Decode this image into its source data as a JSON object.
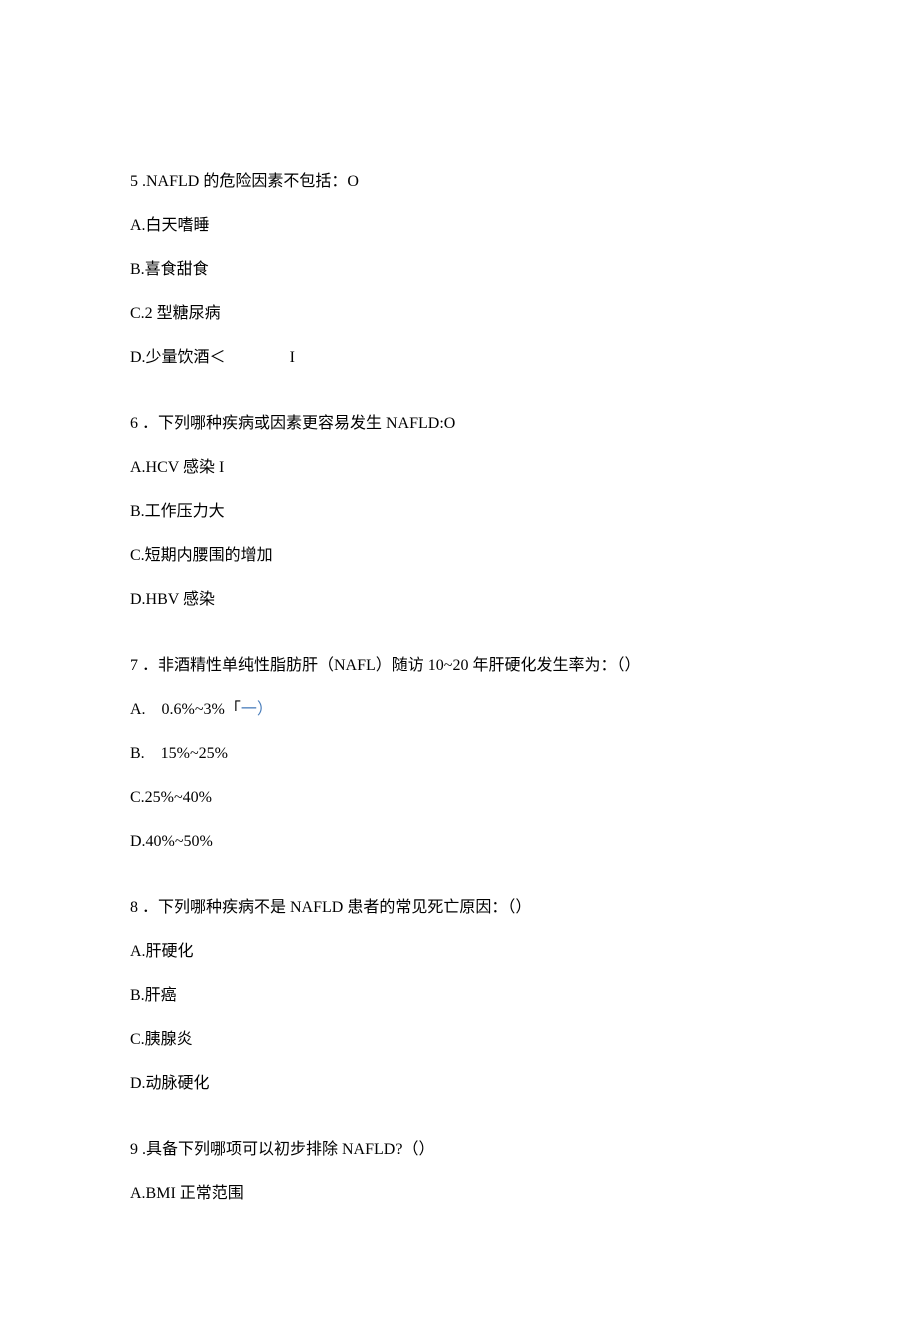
{
  "questions": [
    {
      "number": "5",
      "stem_pre": "",
      "stem": ".NAFLD 的危险因素不包括：O",
      "options": [
        {
          "label": "A.白天嗜睡",
          "annot": ""
        },
        {
          "label": "B.喜食甜食",
          "annot": ""
        },
        {
          "label": "C.2 型糖尿病",
          "annot": ""
        },
        {
          "label": "D.少量饮酒＜",
          "annot": "I"
        }
      ]
    },
    {
      "number": "6",
      "stem_pre": "",
      "stem": "．下列哪种疾病或因素更容易发生 NAFLD:O",
      "options": [
        {
          "label": "A.HCV 感染 I",
          "annot": ""
        },
        {
          "label": "B.工作压力大",
          "annot": ""
        },
        {
          "label": "C.短期内腰围的增加",
          "annot": ""
        },
        {
          "label": "D.HBV 感染",
          "annot": ""
        }
      ]
    },
    {
      "number": "7",
      "stem_pre": "",
      "stem": "．非酒精性单纯性脂肪肝（NAFL）随访 10~20 年肝硬化发生率为：（）",
      "options": [
        {
          "label": "A.　0.6%~3%「一）",
          "annot": "",
          "blue_span": "一）"
        },
        {
          "label": "B.　15%~25%",
          "annot": ""
        },
        {
          "label": "C.25%~40%",
          "annot": ""
        },
        {
          "label": "D.40%~50%",
          "annot": ""
        }
      ]
    },
    {
      "number": "8",
      "stem_pre": "",
      "stem": "．下列哪种疾病不是 NAFLD 患者的常见死亡原因：（）",
      "options": [
        {
          "label": "A.肝硬化",
          "annot": ""
        },
        {
          "label": "B.肝癌",
          "annot": ""
        },
        {
          "label": "C.胰腺炎",
          "annot": ""
        },
        {
          "label": "D.动脉硬化",
          "annot": ""
        }
      ]
    },
    {
      "number": "9",
      "stem_pre": "",
      "stem": ".具备下列哪项可以初步排除 NAFLD?（）",
      "options": [
        {
          "label": "A.BMI 正常范围",
          "annot": ""
        }
      ]
    }
  ]
}
